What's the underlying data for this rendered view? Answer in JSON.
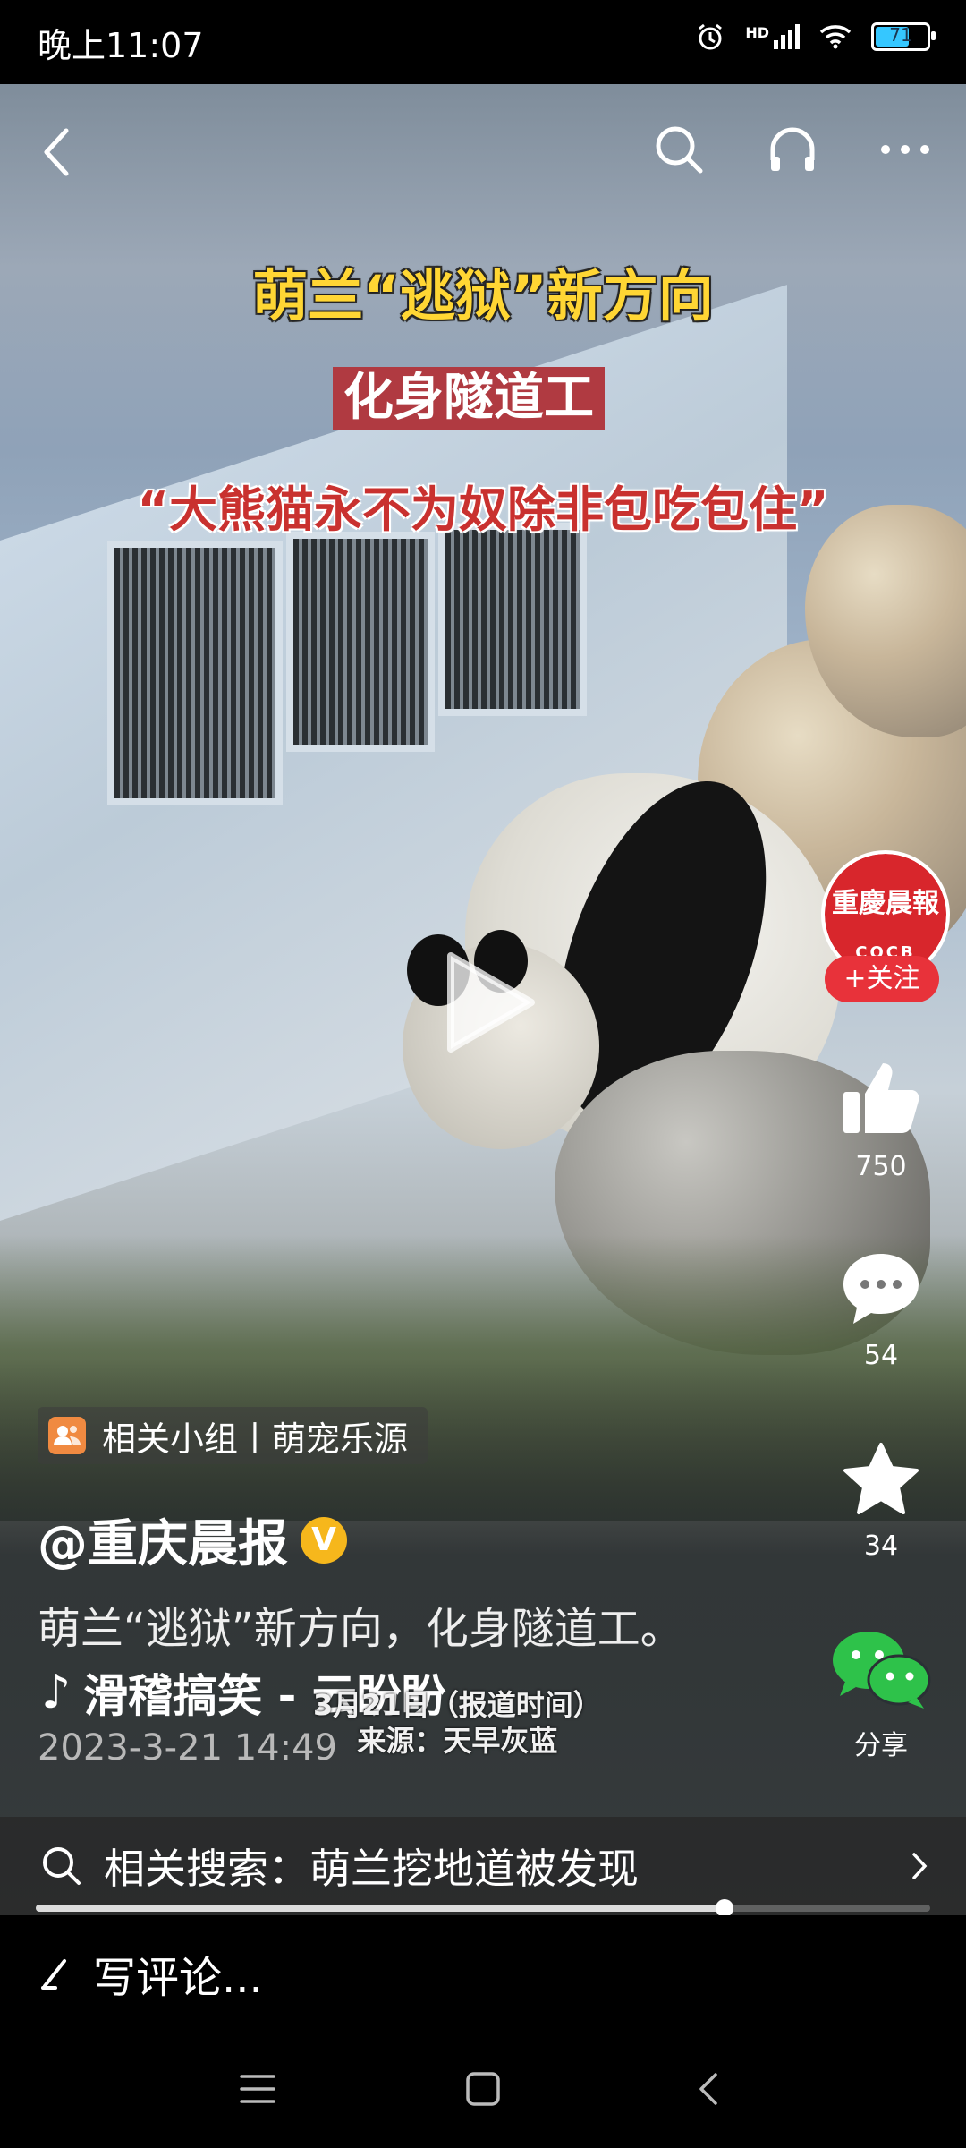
{
  "status_bar": {
    "time": "晚上11:07",
    "network": "HD",
    "battery": "71",
    "battery_color": "#35c7ff"
  },
  "top_bar": {
    "back_icon": "back-arrow-icon",
    "search_icon": "search-icon",
    "listen_icon": "headphones-icon",
    "more_icon": "more-dots-icon"
  },
  "captions": {
    "title": "萌兰“逃狱”新方向",
    "subtitle": "化身隧道工",
    "quote": "“大熊猫永不为奴除非包吃包住”"
  },
  "author_avatar": {
    "name": "重慶晨報",
    "abbr": "CQCB",
    "follow_label": "+关注",
    "brand_color": "#d8262c"
  },
  "actions": {
    "like_count": "750",
    "comment_count": "54",
    "favorite_count": "34",
    "share_label": "分享"
  },
  "group_tag": {
    "label": "相关小组丨萌宠乐源"
  },
  "post": {
    "author": "@重庆晨报",
    "verified": "V",
    "description": "萌兰“逃狱”新方向，化身隧道工。",
    "music": "滑稽搞笑 - 云盼盼",
    "datetime": "2023-3-21 14:49",
    "burned_line1": "3月21日（报道时间）",
    "burned_line2": "来源：天早灰蓝"
  },
  "related_search": {
    "label": "相关搜索：萌兰挖地道被发现"
  },
  "playback": {
    "progress": 0.77
  },
  "comment": {
    "placeholder": "写评论..."
  },
  "nav": {
    "menu_icon": "menu-icon",
    "home_icon": "home-square-icon",
    "back_icon": "nav-back-icon"
  }
}
